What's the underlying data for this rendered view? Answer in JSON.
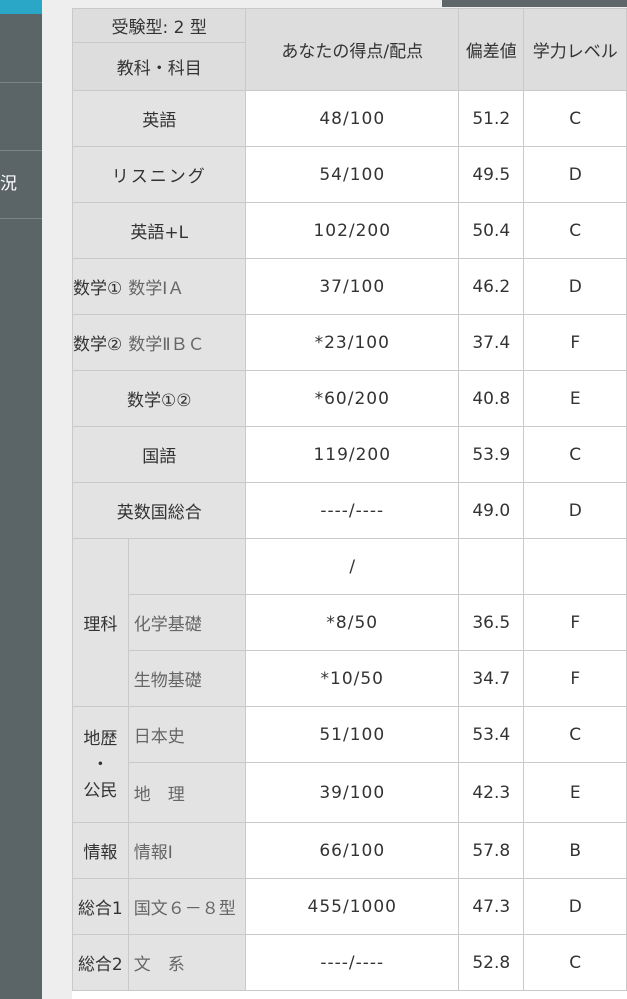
{
  "sidebar": {
    "fragment": "況"
  },
  "header": {
    "exam_type": "受験型: 2 型",
    "subject": "教科・科目",
    "score": "あなたの得点/配点",
    "deviation": "偏差値",
    "level": "学力レベル"
  },
  "rows": {
    "english": {
      "label": "英語",
      "score": "48/100",
      "dev": "51.2",
      "level": "C"
    },
    "listening": {
      "label": "リスニング",
      "score": "54/100",
      "dev": "49.5",
      "level": "D"
    },
    "english_l": {
      "label": "英語+L",
      "score": "102/200",
      "dev": "50.4",
      "level": "C"
    },
    "math1": {
      "label_a": "数学①",
      "label_b": "数学ⅠＡ",
      "score": "37/100",
      "dev": "46.2",
      "level": "D"
    },
    "math2": {
      "label_a": "数学②",
      "label_b": "数学ⅡＢＣ",
      "score": "*23/100",
      "dev": "37.4",
      "level": "F"
    },
    "math12": {
      "label": "数学①②",
      "score": "*60/200",
      "dev": "40.8",
      "level": "E"
    },
    "japanese": {
      "label": "国語",
      "score": "119/200",
      "dev": "53.9",
      "level": "C"
    },
    "eng_math_jpn": {
      "label": "英数国総合",
      "score": "----/----",
      "dev": "49.0",
      "level": "D"
    },
    "science": {
      "label": "理科",
      "blank": {
        "subject": "",
        "score": "/",
        "dev": "",
        "level": ""
      },
      "chem": {
        "subject": "化学基礎",
        "score": "*8/50",
        "dev": "36.5",
        "level": "F"
      },
      "bio": {
        "subject": "生物基礎",
        "score": "*10/50",
        "dev": "34.7",
        "level": "F"
      }
    },
    "social": {
      "label_top": "地歴",
      "label_mid": "・",
      "label_bottom": "公民",
      "history": {
        "subject": "日本史",
        "score": "51/100",
        "dev": "53.4",
        "level": "C"
      },
      "geo": {
        "subject": "地　理",
        "score": "39/100",
        "dev": "42.3",
        "level": "E"
      }
    },
    "info": {
      "label": "情報",
      "subject": "情報Ⅰ",
      "score": "66/100",
      "dev": "57.8",
      "level": "B"
    },
    "total1": {
      "label": "総合1",
      "subject": "国文６－８型",
      "score": "455/1000",
      "dev": "47.3",
      "level": "D"
    },
    "total2": {
      "label": "総合2",
      "subject": "文　系",
      "score": "----/----",
      "dev": "52.8",
      "level": "C"
    }
  }
}
